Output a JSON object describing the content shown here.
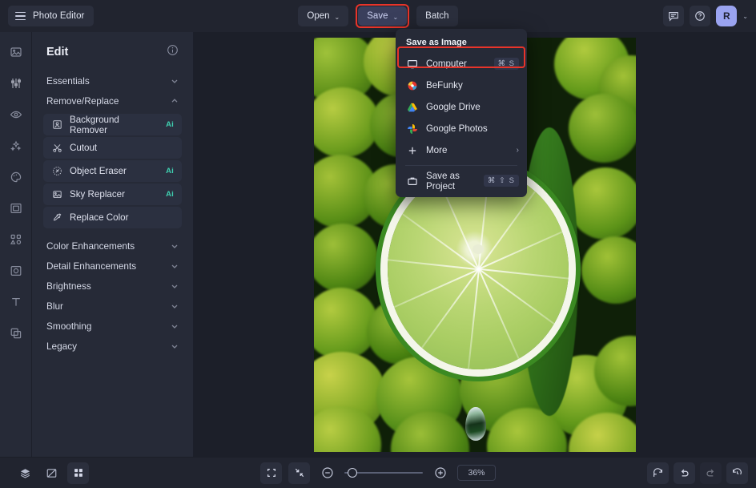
{
  "app": {
    "title": "Photo Editor",
    "brand_icon": "hamburger-menu-icon"
  },
  "toolbar": {
    "open_label": "Open",
    "save_label": "Save",
    "batch_label": "Batch",
    "caret_glyph": "⌄",
    "feedback_icon": "chat-bubble-icon",
    "help_icon": "question-circle-icon",
    "avatar_initial": "R",
    "avatar_color": "#9aa3f0",
    "highlight_color": "#e8342a"
  },
  "save_menu": {
    "title": "Save as Image",
    "items": [
      {
        "label": "Computer",
        "icon": "monitor-icon",
        "shortcut": "⌘ S",
        "highlighted": true
      },
      {
        "label": "BeFunky",
        "icon": "befunky-logo-icon",
        "shortcut": ""
      },
      {
        "label": "Google Drive",
        "icon": "google-drive-icon",
        "shortcut": ""
      },
      {
        "label": "Google Photos",
        "icon": "google-photos-icon",
        "shortcut": ""
      },
      {
        "label": "More",
        "icon": "plus-icon",
        "shortcut": "",
        "submenu": true
      }
    ],
    "project_item": {
      "label": "Save as Project",
      "icon": "briefcase-icon",
      "shortcut": "⌘ ⇧ S"
    },
    "submenu_arrow": "›"
  },
  "rail": {
    "items": [
      {
        "name": "image-icon"
      },
      {
        "name": "sliders-icon"
      },
      {
        "name": "eye-icon"
      },
      {
        "name": "sparkles-icon"
      },
      {
        "name": "palette-icon"
      },
      {
        "name": "frame-icon"
      },
      {
        "name": "shapes-icon"
      },
      {
        "name": "crop-overlay-icon"
      },
      {
        "name": "text-icon"
      },
      {
        "name": "layers-copy-icon"
      }
    ]
  },
  "panel": {
    "title": "Edit",
    "info_icon": "info-circle-icon",
    "sections": [
      {
        "label": "Essentials",
        "expanded": false
      },
      {
        "label": "Remove/Replace",
        "expanded": true
      },
      {
        "label": "Color Enhancements",
        "expanded": false
      },
      {
        "label": "Detail Enhancements",
        "expanded": false
      },
      {
        "label": "Brightness",
        "expanded": false
      },
      {
        "label": "Blur",
        "expanded": false
      },
      {
        "label": "Smoothing",
        "expanded": false
      },
      {
        "label": "Legacy",
        "expanded": false
      }
    ],
    "remove_replace_items": [
      {
        "label": "Background Remover",
        "icon": "portrait-icon",
        "badge": "Ai"
      },
      {
        "label": "Cutout",
        "icon": "scissors-icon",
        "badge": ""
      },
      {
        "label": "Object Eraser",
        "icon": "eraser-icon",
        "badge": "Ai"
      },
      {
        "label": "Sky Replacer",
        "icon": "sky-icon",
        "badge": "Ai"
      },
      {
        "label": "Replace Color",
        "icon": "eyedropper-icon",
        "badge": ""
      }
    ],
    "ai_badge_color": "#3fd0b0"
  },
  "canvas": {
    "image_description": "close-up of a sliced lime over a pile of whole limes with a juice droplet"
  },
  "bottombar": {
    "left_buttons": [
      {
        "icon": "layers-icon"
      },
      {
        "icon": "compare-icon"
      },
      {
        "icon": "grid-icon",
        "active": true
      }
    ],
    "center_buttons": [
      {
        "icon": "fit-screen-icon"
      },
      {
        "icon": "collapse-icon"
      }
    ],
    "zoom_out_icon": "minus-circle-icon",
    "zoom_in_icon": "plus-circle-icon",
    "zoom_value": "36%",
    "right_buttons": [
      {
        "icon": "reset-rotate-icon"
      },
      {
        "icon": "undo-icon"
      },
      {
        "icon": "redo-icon",
        "disabled": true
      },
      {
        "icon": "history-icon"
      }
    ]
  }
}
